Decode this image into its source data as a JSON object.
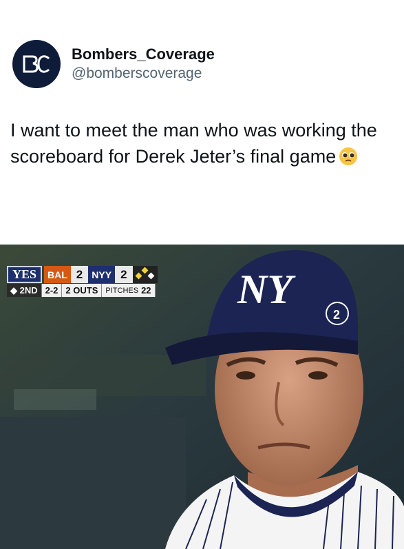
{
  "tweet": {
    "display_name": "Bombers_Coverage",
    "handle": "@bomberscoverage",
    "avatar_text": "BC",
    "text": "I want to meet the man who was working the scoreboard for Derek Jeter’s final game",
    "emoji_icon": "pleading-face-emoji"
  },
  "scorebug": {
    "network": "YES",
    "away_team": "BAL",
    "away_score": "2",
    "home_team": "NYY",
    "home_score": "2",
    "inning": "2ND",
    "count": "2-2",
    "outs": "2 OUTS",
    "pitches_label": "PITCHES",
    "pitches": "22"
  },
  "colors": {
    "avatar_bg": "#0e1c3a",
    "yankees_navy": "#1d2f6e",
    "orioles_orange": "#d45a14"
  }
}
